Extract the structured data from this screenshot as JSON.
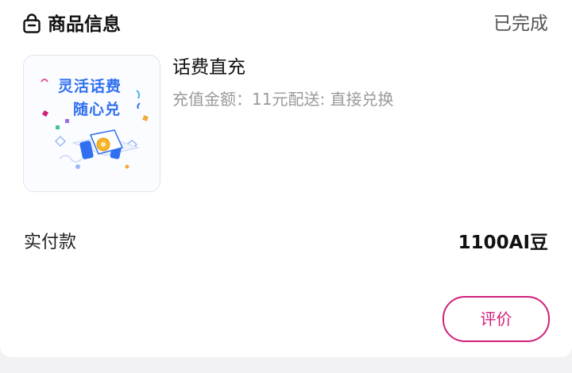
{
  "header": {
    "icon": "shopping-bag-icon",
    "title": "商品信息",
    "status": "已完成"
  },
  "product": {
    "thumbnail": {
      "line1": "灵活话费",
      "line2": "随心兑"
    },
    "title": "话费直充",
    "spec": "充值金额：11元配送: 直接兑换"
  },
  "payment": {
    "label": "实付款",
    "amount": "1100AI豆"
  },
  "actions": {
    "review_label": "评价"
  },
  "colors": {
    "accent": "#d1207a",
    "thumb_text": "#2f6ff0"
  }
}
